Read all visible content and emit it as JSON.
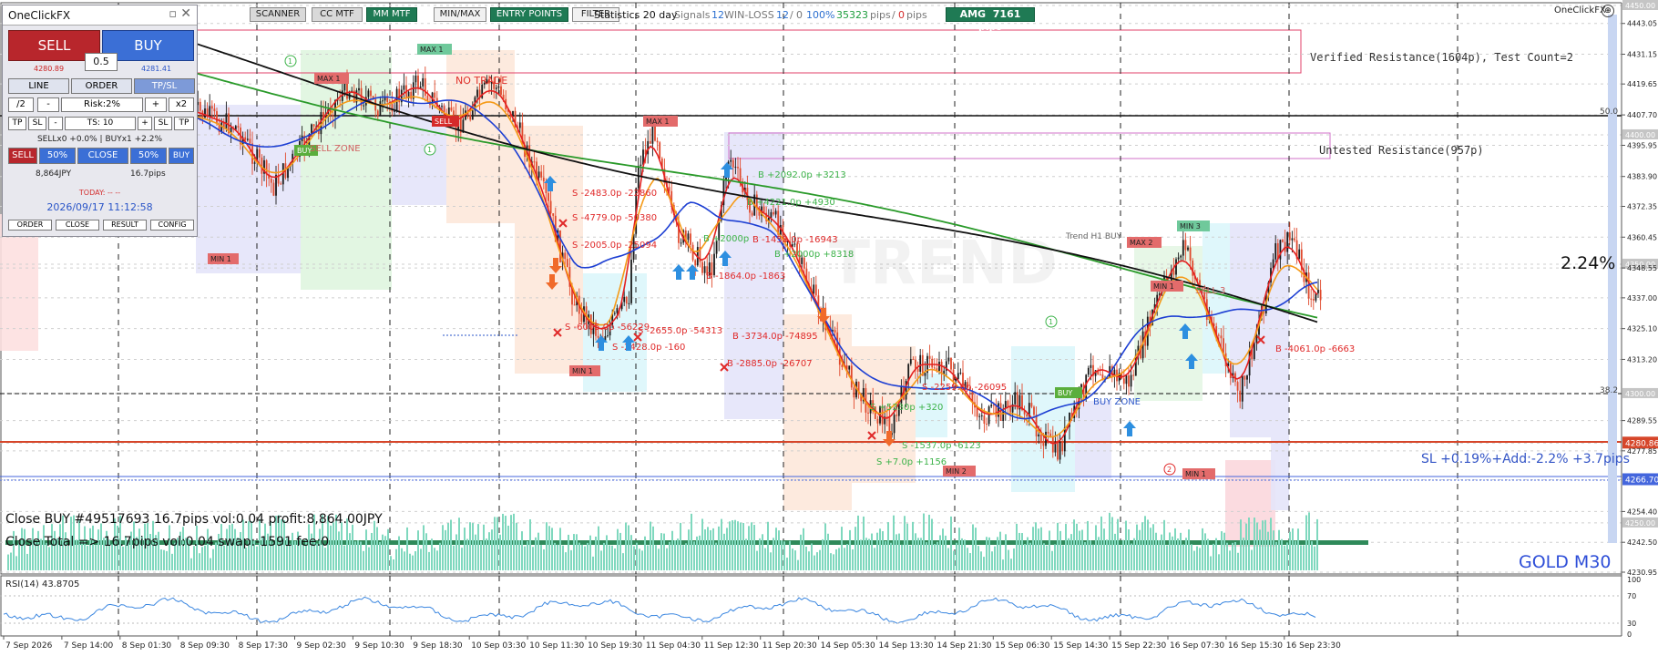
{
  "window": {
    "brand": "OneClickFX",
    "symbol_label": "GOLD M30"
  },
  "toolbar": {
    "buttons": [
      "SCANNER",
      "CC MTF",
      "MM MTF",
      "MIN/MAX",
      "ENTRY POINTS",
      "FILTER"
    ],
    "statistics_label": "Statistics 20 day",
    "signals_label": "Signals",
    "signals_value": "12",
    "winloss_label": "WIN-LOSS",
    "win_value": "12",
    "loss_value": "0",
    "win_pct": "100%",
    "pips_pos": "35323",
    "pips_word": "pips",
    "pips_neg": "0",
    "pips_word2": "pips",
    "amg_label": "AMG",
    "amg_value": "7161 pips"
  },
  "panel": {
    "title": "OneClickFX",
    "sell_label": "SELL",
    "buy_label": "BUY",
    "lot": "0.5",
    "sell_price": "4280.89",
    "buy_price": "4281.41",
    "tabs": [
      "LINE",
      "ORDER",
      "TP/SL"
    ],
    "half": "/2",
    "minus": "-",
    "risk": "Risk:2%",
    "plus": "+",
    "double": "x2",
    "tp_l": "TP",
    "sl_l": "SL",
    "ts": "TS: 10",
    "sl_r": "SL",
    "tp_r": "TP",
    "positions_info": "SELLx0 +0.0% | BUYx1 +2.2%",
    "sell_small": "SELL",
    "pct50a": "50%",
    "close": "CLOSE",
    "pct50b": "50%",
    "buy_small": "BUY",
    "profit_jpy": "8,864JPY",
    "profit_pips": "16.7pips",
    "today": "TODAY: -- --",
    "datetime": "2026/09/17  11:12:58",
    "bottom_buttons": [
      "ORDER",
      "CLOSE",
      "RESULT",
      "CONFIG"
    ]
  },
  "zones": {
    "verified_resistance": "Verified Resistance(1604p), Test Count=2",
    "untested_resistance": "Untested Resistance(957p)"
  },
  "annotations": {
    "percent": "2.24%",
    "sl_info": "SL +0.19%+Add:-2.2% +3.7pips",
    "close_info_1": "Close BUY #49517693 16.7pips vol:0.04 profit:8,864.00JPY",
    "close_info_2": "Close Total => 16.7pips vol:0.04 swap:-1591 fee:0",
    "fib_500": "50.0",
    "fib_382": "38.2",
    "trend_h1": "Trend H1 BUY",
    "no_trade": "NO TRADE",
    "watermark": "TREND",
    "tags": {
      "max1_a": "MAX 1",
      "max1_b": "MAX 1",
      "max1_c": "MAX 1",
      "max2": "MAX 2",
      "min3": "MIN 3",
      "min1_a": "MIN 1",
      "min1_b": "MIN 1",
      "min2": "MIN 2",
      "min1_c": "MIN 1",
      "sell_flag": "SELL",
      "buy_flag_a": "BUY",
      "buy_flag_b": "BUY"
    },
    "signals": {
      "s1": "S -2483.0p -22860",
      "s2": "S -4779.0p -50380",
      "s3": "S -2005.0p -25094",
      "s4": "S -6005.0p -56229",
      "s5": "S -2428.0p -160",
      "s6": "S -2655.0p -54313",
      "b1": "B -3734.0p -74895",
      "b2": "B -2885.0p -26707",
      "b3": "B -1864.0p -1863",
      "b4": "B +2092.0p +3213",
      "b5": "B +4221.0p +4930",
      "b6": "B +2000p",
      "b7": "B -1458.0p -16943",
      "b8": "B +2000p +8318",
      "b9": "B -4061.0p -6663",
      "s7": "S -1537.0p -6123",
      "s8": "S +5330p +320",
      "s9": "S +7.0p +1156",
      "s10": "S -2259.0p -26095",
      "sell_zone": "SELL ZONE",
      "buy_zone": "BUY ZONE",
      "sell_label2": "SELL 3"
    }
  },
  "price_axis": {
    "ticks": [
      "4450.00",
      "4443.05",
      "4431.15",
      "4419.65",
      "4407.70",
      "4400.00",
      "4395.95",
      "4383.90",
      "4372.35",
      "4360.45",
      "4350.00",
      "4348.55",
      "4337.00",
      "4325.10",
      "4313.20",
      "4300.00",
      "4289.55",
      "4280.86",
      "4277.85",
      "4266.70",
      "4254.40",
      "4250.00",
      "4242.50",
      "4230.95"
    ],
    "current_price": "4280.86",
    "rsi_ticks": [
      "100",
      "70",
      "30",
      "0"
    ]
  },
  "rsi": {
    "label": "RSI(14) 43.8705"
  },
  "time_axis": [
    "7 Sep 2026",
    "7 Sep 14:00",
    "8 Sep 01:30",
    "8 Sep 09:30",
    "8 Sep 17:30",
    "9 Sep 02:30",
    "9 Sep 10:30",
    "9 Sep 18:30",
    "10 Sep 03:30",
    "10 Sep 11:30",
    "10 Sep 19:30",
    "11 Sep 04:30",
    "11 Sep 12:30",
    "11 Sep 20:30",
    "14 Sep 05:30",
    "14 Sep 13:30",
    "14 Sep 21:30",
    "15 Sep 06:30",
    "15 Sep 14:30",
    "15 Sep 22:30",
    "16 Sep 07:30",
    "16 Sep 15:30",
    "16 Sep 23:30"
  ],
  "colors": {
    "sell": "#b8262c",
    "buy": "#3b6fd6",
    "up": "#1a1a1a",
    "down": "#e0482b",
    "ema_red": "#e42020",
    "ema_orange": "#f59a17",
    "ema_blue": "#1d3fd3",
    "ema_green": "#2a9a2a",
    "ema_black": "#111111",
    "volume": "#7fd8be",
    "rsi": "#3a86e0",
    "toolbar_green": "#1f7a54"
  }
}
